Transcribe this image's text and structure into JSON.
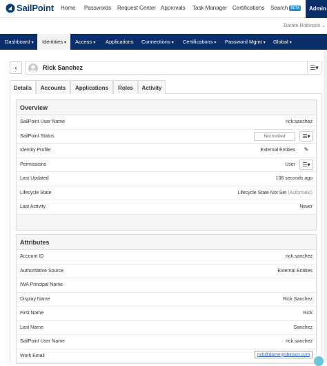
{
  "brand": {
    "name": "SailPoint"
  },
  "topnav": {
    "links": [
      "Home",
      "Passwords",
      "Request Center",
      "Approvals",
      "Task Manager",
      "Certifications",
      "Search"
    ],
    "search_badge": "BETA",
    "admin_label": "Admin",
    "user": "Darren Robinson"
  },
  "mainnav": {
    "items": [
      {
        "label": "Dashboard",
        "chev": "▾"
      },
      {
        "label": "Identities",
        "chev": "▾"
      },
      {
        "label": "Access",
        "chev": "▾"
      },
      {
        "label": "Applications",
        "chev": ""
      },
      {
        "label": "Connections",
        "chev": "▾"
      },
      {
        "label": "Certifications",
        "chev": "▾"
      },
      {
        "label": "Password Mgmt",
        "chev": "▾"
      },
      {
        "label": "Global",
        "chev": "▾"
      }
    ],
    "active_index": 1
  },
  "identity": {
    "name": "Rick Sanchez",
    "back_glyph": "‹"
  },
  "tabs": [
    "Details",
    "Accounts",
    "Applications",
    "Roles",
    "Activity"
  ],
  "overview": {
    "title": "Overview",
    "rows": [
      {
        "label": "SailPoint User Name",
        "value": "rick.sanchez"
      },
      {
        "label": "SailPoint Status",
        "value": "Not Invited"
      },
      {
        "label": "Identity Profile",
        "value": "External Entities"
      },
      {
        "label": "Permissions",
        "value": "User"
      },
      {
        "label": "Last Updated",
        "value": "106 seconds ago"
      },
      {
        "label": "Lifecycle State",
        "value": "Lifecycle State Not Set",
        "note": "(Automatic)"
      },
      {
        "label": "Last Activity",
        "value": "Never"
      }
    ]
  },
  "attributes": {
    "title": "Attributes",
    "rows": [
      {
        "label": "Account ID",
        "value": "rick.sanchez"
      },
      {
        "label": "Authoritative Source",
        "value": "External Entities"
      },
      {
        "label": "IWA Principal Name",
        "value": ""
      },
      {
        "label": "Display Name",
        "value": "Rick Sanchez"
      },
      {
        "label": "First Name",
        "value": "Rick"
      },
      {
        "label": "Last Name",
        "value": "Sanchez"
      },
      {
        "label": "SailPoint User Name",
        "value": "rick.sanchez"
      },
      {
        "label": "Work Email",
        "value": "rick@darrenjrobinson.com"
      }
    ]
  },
  "icons": {
    "menu": "hamburger-dropdown-icon",
    "edit": "pencil-icon"
  },
  "colors": {
    "navy": "#0b2f6b",
    "link": "#2a5ea8",
    "badge": "#2e8ec4"
  }
}
